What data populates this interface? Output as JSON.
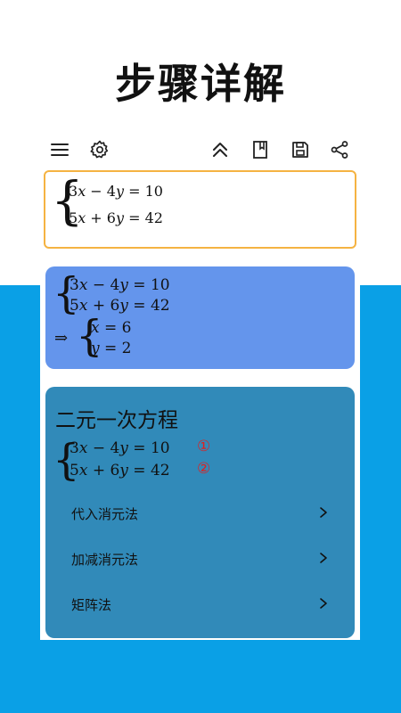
{
  "headline": "步骤详解",
  "toolbar": {
    "icons": [
      "menu-icon",
      "gear-icon",
      "collapse-up-icon",
      "bookmark-icon",
      "save-icon",
      "share-icon"
    ]
  },
  "input": {
    "eq1": {
      "a": "3",
      "x": "x",
      "op": " − 4",
      "y": "y",
      "rhs": " = 10"
    },
    "eq2": {
      "a": "5",
      "x": "x",
      "op": " + 6",
      "y": "y",
      "rhs": " = 42"
    }
  },
  "result": {
    "eq1": {
      "a": "3",
      "x": "x",
      "op": " − 4",
      "y": "y",
      "rhs": " = 10"
    },
    "eq2": {
      "a": "5",
      "x": "x",
      "op": " + 6",
      "y": "y",
      "rhs": " = 42"
    },
    "implies": "⇒",
    "sol1": {
      "var": "x",
      "rhs": " = 6"
    },
    "sol2": {
      "var": "y",
      "rhs": " = 2"
    }
  },
  "method": {
    "title": "二元一次方程",
    "eq1": {
      "a": "3",
      "x": "x",
      "op": " − 4",
      "y": "y",
      "rhs": " = 10"
    },
    "eq2": {
      "a": "5",
      "x": "x",
      "op": " + 6",
      "y": "y",
      "rhs": " = 42"
    },
    "mark1": "①",
    "mark2": "②",
    "items": [
      {
        "label": "代入消元法"
      },
      {
        "label": "加减消元法"
      },
      {
        "label": "矩阵法"
      }
    ]
  },
  "colors": {
    "accent_orange": "#f5b342",
    "result_blue": "#6495ec",
    "method_blue": "#318ab9",
    "background_blue": "#0aa0e6",
    "mark_red": "#e02020"
  }
}
